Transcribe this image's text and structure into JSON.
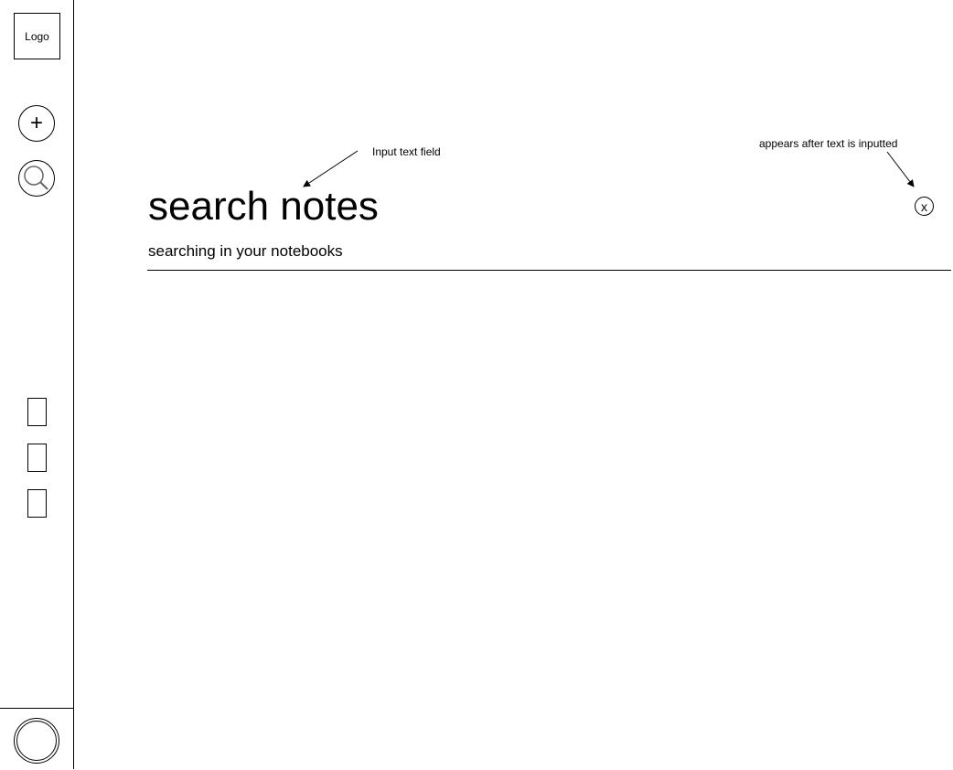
{
  "sidebar": {
    "logo_label": "Logo",
    "add_label": "+",
    "buttons": [
      {
        "name": "add-button",
        "icon": "plus-icon"
      },
      {
        "name": "search-button",
        "icon": "search-icon"
      }
    ],
    "nav_items": [
      "notebook-slot-1",
      "notebook-slot-2",
      "notebook-slot-3"
    ],
    "profile_icon": "avatar-icon"
  },
  "search": {
    "title": "search notes",
    "subtitle": "searching in your notebooks",
    "clear_label": "x"
  },
  "annotations": {
    "input_field": "Input text field",
    "clear_button": "appears after text is inputted"
  }
}
